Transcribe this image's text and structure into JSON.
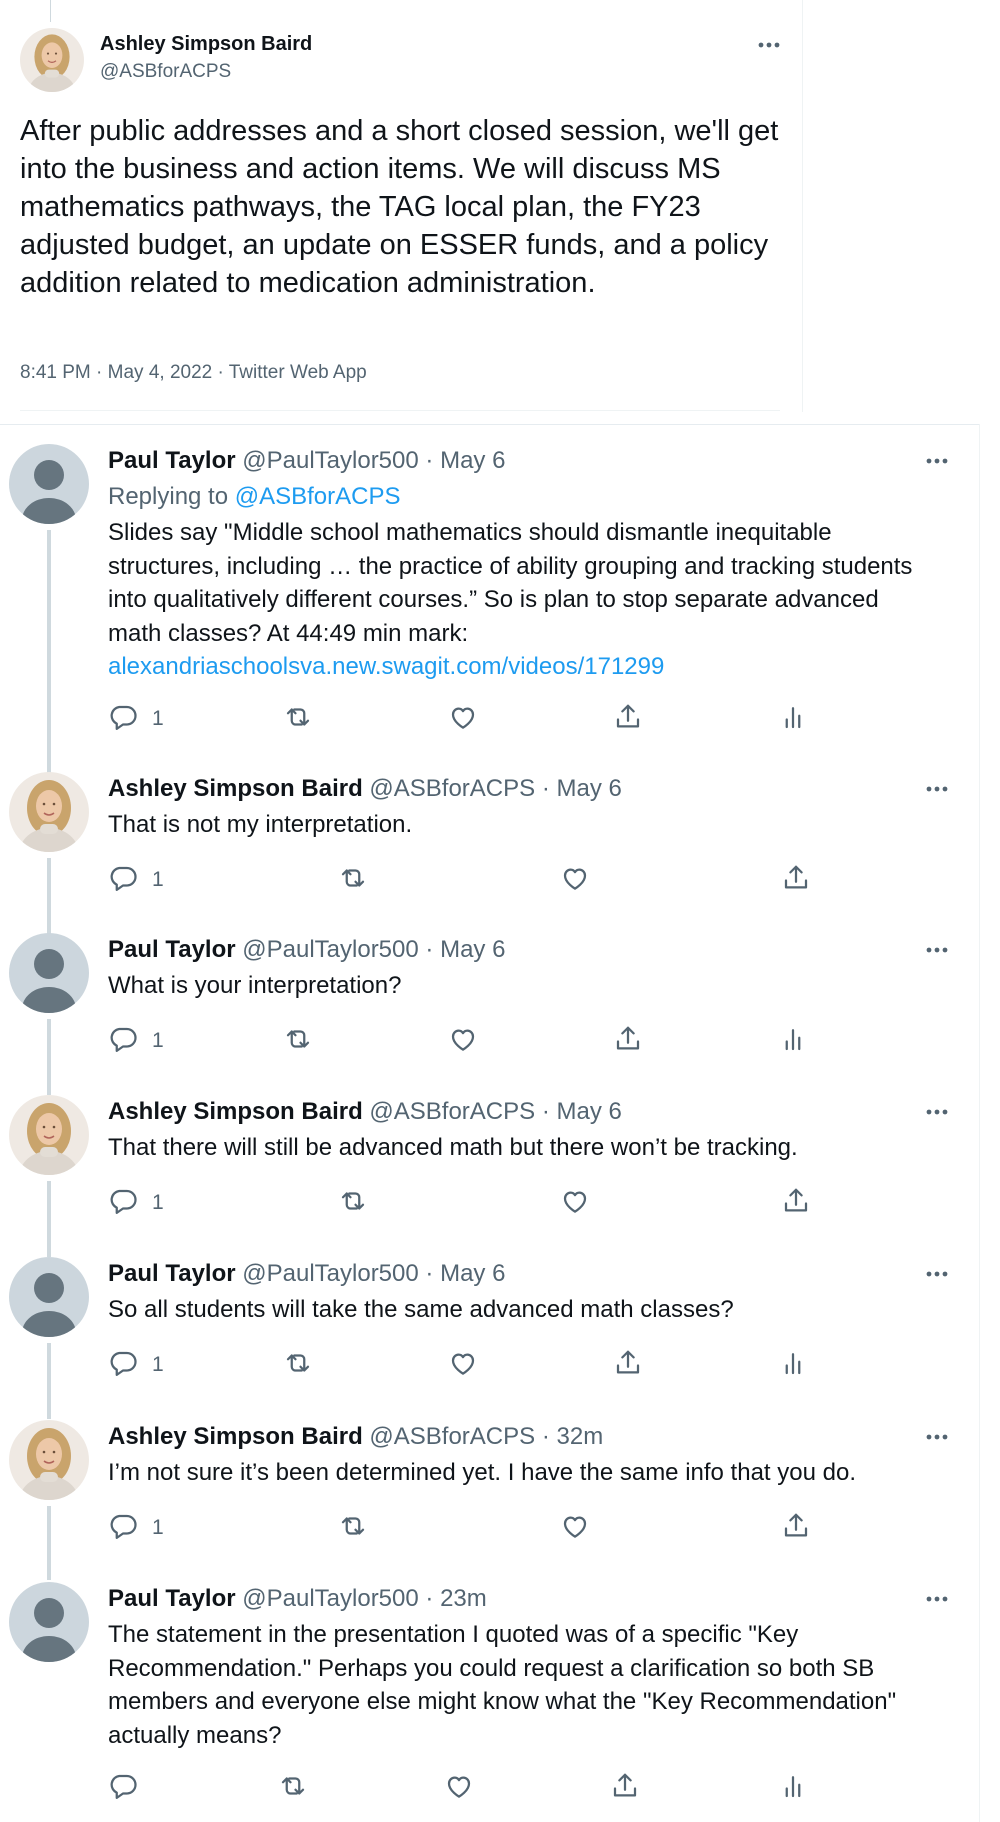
{
  "main_tweet": {
    "name": "Ashley Simpson Baird",
    "handle": "@ASBforACPS",
    "text": "After public addresses and a short closed session, we'll get into the business and action items. We will discuss MS mathematics pathways, the TAG local plan, the FY23 adjusted budget, an update on ESSER funds, and a policy addition related to medication administration.",
    "meta": "8:41 PM · May 4, 2022 · Twitter Web App"
  },
  "replying_label": "Replying to",
  "replying_handle": "@ASBforACPS",
  "replies": [
    {
      "name": "Paul Taylor",
      "handle": "@PaulTaylor500",
      "time": "May 6",
      "avatar": "default",
      "text": "Slides say \"Middle school mathematics should dismantle inequitable structures, including … the practice of ability grouping and tracking students into qualitatively different courses.” So is plan to stop separate advanced math classes?  At 44:49 min mark:",
      "link": "alexandriaschoolsva.new.swagit.com/videos/171299",
      "reply_count": "1"
    },
    {
      "name": "Ashley Simpson Baird",
      "handle": "@ASBforACPS",
      "time": "May 6",
      "avatar": "photo",
      "text": "That is not my interpretation.",
      "reply_count": "1"
    },
    {
      "name": "Paul Taylor",
      "handle": "@PaulTaylor500",
      "time": "May 6",
      "avatar": "default",
      "text": "What is your interpretation?",
      "reply_count": "1"
    },
    {
      "name": "Ashley Simpson Baird",
      "handle": "@ASBforACPS",
      "time": "May 6",
      "avatar": "photo",
      "text": "That there will still be advanced math but there won’t be tracking.",
      "reply_count": "1"
    },
    {
      "name": "Paul Taylor",
      "handle": "@PaulTaylor500",
      "time": "May 6",
      "avatar": "default",
      "text": "So all students will take the same advanced math classes?",
      "reply_count": "1"
    },
    {
      "name": "Ashley Simpson Baird",
      "handle": "@ASBforACPS",
      "time": "32m",
      "avatar": "photo",
      "text": "I’m not sure it’s been determined yet. I have the same info that you do.",
      "reply_count": "1"
    },
    {
      "name": "Paul Taylor",
      "handle": "@PaulTaylor500",
      "time": "23m",
      "avatar": "default",
      "text": "The statement in the presentation I quoted was of a specific \"Key Recommendation.\" Perhaps you could request a clarification so both SB members and everyone else might know what the \"Key Recommendation\" actually means?",
      "reply_count": ""
    }
  ],
  "icons": {
    "reply": "reply-icon",
    "retweet": "retweet-icon",
    "like": "like-icon",
    "share": "share-icon",
    "analytics": "analytics-icon",
    "more": "more-icon"
  },
  "colors": {
    "accent": "#1d9bf0",
    "text": "#0f1419",
    "secondary": "#536471",
    "line": "#cfd9de"
  }
}
